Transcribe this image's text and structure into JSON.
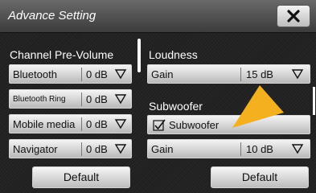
{
  "window": {
    "title": "Advance Setting"
  },
  "close": {
    "icon": "close-x-icon"
  },
  "channel": {
    "heading": "Channel Pre-Volume",
    "rows": [
      {
        "label": "Bluetooth",
        "value": "0 dB"
      },
      {
        "label": "Bluetooth Ring",
        "value": "0 dB"
      },
      {
        "label": "Mobile media",
        "value": "0 dB"
      },
      {
        "label": "Navigator",
        "value": "0 dB"
      }
    ],
    "default_label": "Default"
  },
  "loudness": {
    "heading": "Loudness",
    "gain_label": "Gain",
    "gain_value": "15 dB"
  },
  "subwoofer": {
    "heading": "Subwoofer",
    "toggle_label": "Subwoofer",
    "checked": true,
    "gain_label": "Gain",
    "gain_value": "10 dB"
  },
  "right_default_label": "Default",
  "colors": {
    "pointer_arrow": "#f5b020",
    "background": "#202020"
  }
}
